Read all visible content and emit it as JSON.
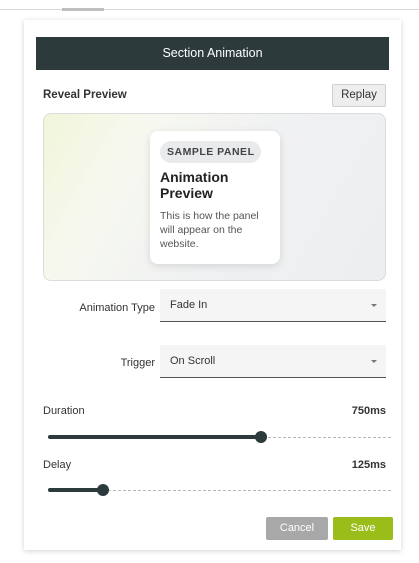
{
  "dialog": {
    "title": "Section Animation",
    "preview_label": "Reveal Preview",
    "replay_label": "Replay"
  },
  "preview": {
    "badge": "SAMPLE PANEL",
    "title": "Animation Preview",
    "text": "This is how the panel will appear on the website."
  },
  "fields": {
    "animation_type": {
      "label": "Animation Type",
      "value": "Fade In"
    },
    "trigger": {
      "label": "Trigger",
      "value": "On Scroll"
    }
  },
  "sliders": {
    "duration": {
      "label": "Duration",
      "value_text": "750ms",
      "fraction": 0.62
    },
    "delay": {
      "label": "Delay",
      "value_text": "125ms",
      "fraction": 0.16
    }
  },
  "footer": {
    "cancel_label": "Cancel",
    "save_label": "Save"
  },
  "colors": {
    "header_bg": "#2d3a3c",
    "accent_save": "#9bbd1a",
    "cancel_bg": "#a8a8a8"
  }
}
